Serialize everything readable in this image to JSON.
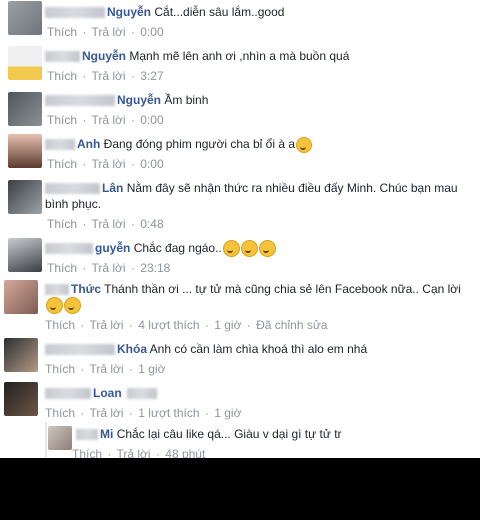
{
  "comments": [
    {
      "name": "Nguyễn",
      "text": "Cắt...diễn sâu lắm..good",
      "actions": {
        "like": "Thích",
        "reply": "Trả lời",
        "time": "0:00"
      }
    },
    {
      "name": "Nguyễn",
      "text": "Mạnh mẽ lên anh ơi ,nhìn a mà buồn quá",
      "actions": {
        "like": "Thích",
        "reply": "Trả lời",
        "time": "3:27"
      }
    },
    {
      "name": "Nguyễn",
      "text": "Ầm binh",
      "actions": {
        "like": "Thích",
        "reply": "Trả lời",
        "time": "0:00"
      }
    },
    {
      "name": "Anh",
      "text": "Đang đóng phim người cha bỉ ổi à a",
      "actions": {
        "like": "Thích",
        "reply": "Trả lời",
        "time": "0:00"
      }
    },
    {
      "name": "Lân",
      "text": "Nằm đây sẽ nhận thức ra nhiều điều đấy Minh. Chúc bạn mau",
      "text2": "bình phục.",
      "actions": {
        "like": "Thích",
        "reply": "Trả lời",
        "time": "0:48"
      }
    },
    {
      "name": "guyễn",
      "text": "Chắc đag ngáo..",
      "actions": {
        "like": "Thích",
        "reply": "Trả lời",
        "time": "23:18"
      }
    },
    {
      "name": "Thức",
      "text": "Thánh thần ơi ... tự tử mà cũng chia sẻ lên Facebook nữa.. Cạn lời",
      "actions": {
        "like": "Thích",
        "reply": "Trả lời",
        "likes": "4 lượt thích",
        "time": "1 giờ",
        "edited": "Đã chỉnh sửa"
      }
    },
    {
      "name": "Khóa",
      "text": "Anh có cần làm chìa khoá thì alo em nhá",
      "actions": {
        "like": "Thích",
        "reply": "Trả lời",
        "time": "1 giờ"
      }
    },
    {
      "name": "Loan",
      "text": "",
      "actions": {
        "like": "Thích",
        "reply": "Trả lời",
        "likes": "1 lượt thích",
        "time": "1 giờ"
      }
    },
    {
      "name": "Mi",
      "text": "Chắc lại câu like qá... Giàu v dại gì tự tử tr",
      "actions": {
        "like": "Thích",
        "reply": "Trả lời",
        "time": "48 phút"
      }
    }
  ],
  "separator": "·",
  "colors": {
    "link": "#365899",
    "meta": "#90949c",
    "text": "#1d2129"
  },
  "icons": {
    "emoji": "grinning-sweat-emoji-icon"
  }
}
